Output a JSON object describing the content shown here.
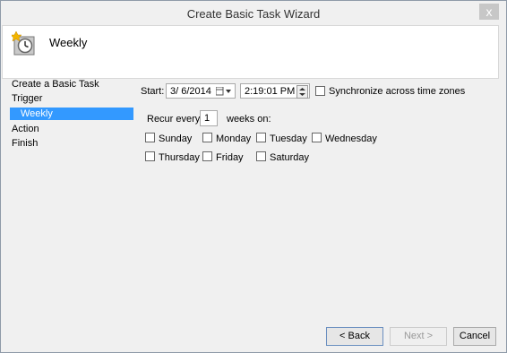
{
  "window": {
    "title": "Create Basic Task Wizard",
    "close_label": "x"
  },
  "header": {
    "title": "Weekly"
  },
  "sidebar": {
    "items": [
      {
        "label": "Create a Basic Task"
      },
      {
        "label": "Trigger"
      },
      {
        "label": "Weekly"
      },
      {
        "label": "Action"
      },
      {
        "label": "Finish"
      }
    ]
  },
  "form": {
    "start_label": "Start:",
    "date_value": "3/ 6/2014",
    "time_value": "2:19:01 PM",
    "sync_label": "Synchronize across time zones",
    "recur_label": "Recur every:",
    "recur_value": "1",
    "weeks_on_label": "weeks on:",
    "days": [
      "Sunday",
      "Monday",
      "Tuesday",
      "Wednesday",
      "Thursday",
      "Friday",
      "Saturday"
    ]
  },
  "buttons": {
    "back": "< Back",
    "next": "Next >",
    "cancel": "Cancel"
  }
}
